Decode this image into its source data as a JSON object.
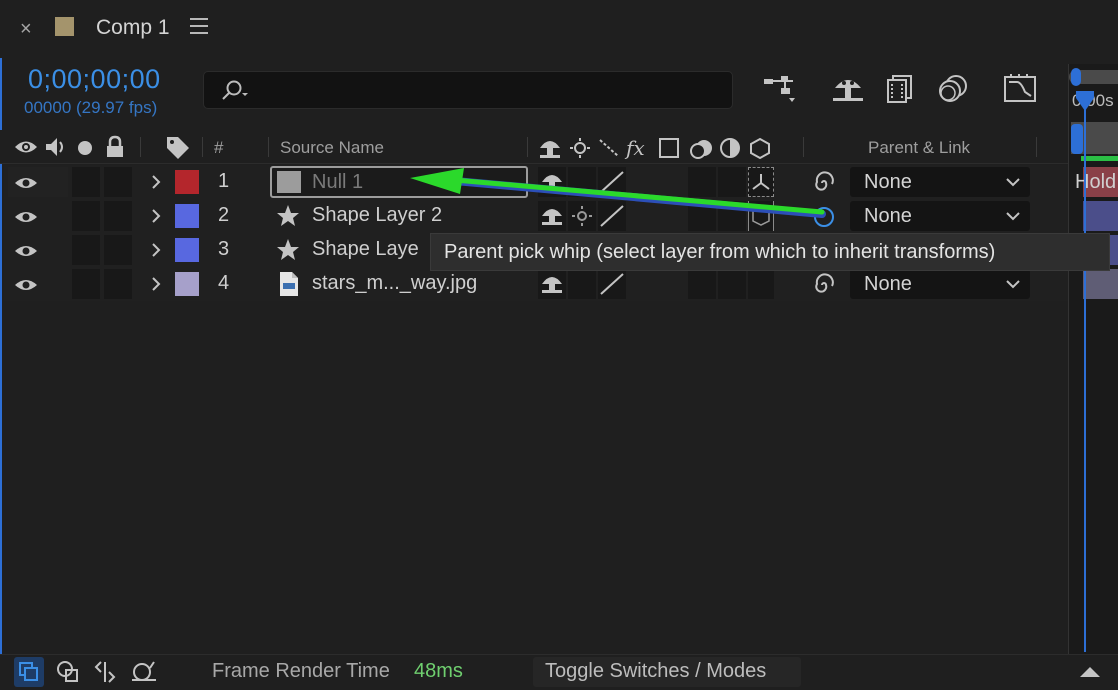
{
  "header": {
    "close_glyph": "×",
    "tab_title": "Comp 1",
    "timecode": "0;00;00;00",
    "fps": "00000 (29.97 fps)",
    "search_placeholder": ""
  },
  "columns": {
    "num": "#",
    "source_name": "Source Name",
    "parent_link": "Parent & Link"
  },
  "rows": [
    {
      "num": "1",
      "name": "Null 1",
      "color": "#b4262c",
      "parent": "None",
      "type": "null"
    },
    {
      "num": "2",
      "name": "Shape Layer 2",
      "color": "#5868e0",
      "parent": "None",
      "type": "shape"
    },
    {
      "num": "3",
      "name": "Shape Laye",
      "color": "#5868e0",
      "parent": "",
      "type": "shape"
    },
    {
      "num": "4",
      "name": "stars_m..._way.jpg",
      "color": "#a6a0ca",
      "parent": "None",
      "type": "image"
    }
  ],
  "tooltip": "Parent pick whip (select layer from which to inherit transforms)",
  "timeline": {
    "time_label": "0:00s",
    "bar_label": "Hold"
  },
  "footer": {
    "render_label": "Frame Render Time",
    "render_value": "48ms",
    "toggle_label": "Toggle Switches / Modes"
  },
  "colors": {
    "accent": "#3b8fe6",
    "arrow": "#2bd92b",
    "render_value": "#6fcf6f"
  }
}
